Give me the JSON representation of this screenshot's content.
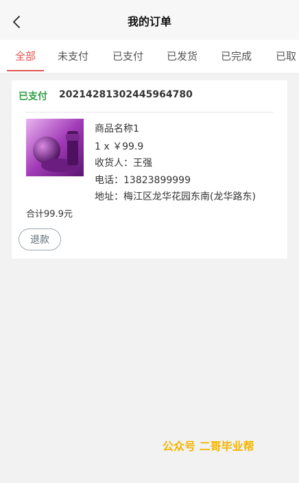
{
  "header": {
    "title": "我的订单",
    "back_icon": "chevron-left-icon"
  },
  "tabs": [
    "全部",
    "未支付",
    "已支付",
    "已发货",
    "已完成",
    "已取"
  ],
  "active_tab": "全部",
  "order": {
    "status": "已支付",
    "order_no": "20214281302445964780",
    "product_name": "商品名称1",
    "qty_price": "1 x ￥99.9",
    "receiver": "收货人：王强",
    "phone": "电话：13823899999",
    "address": "地址：梅江区龙华花园东南(龙华路东)",
    "total": "合计99.9元",
    "refund_label": "退款"
  },
  "watermark": "公众号 二哥毕业帮",
  "colors": {
    "accent": "#e0534f",
    "status_paid": "#2f9e44",
    "watermark": "#f4b400"
  }
}
